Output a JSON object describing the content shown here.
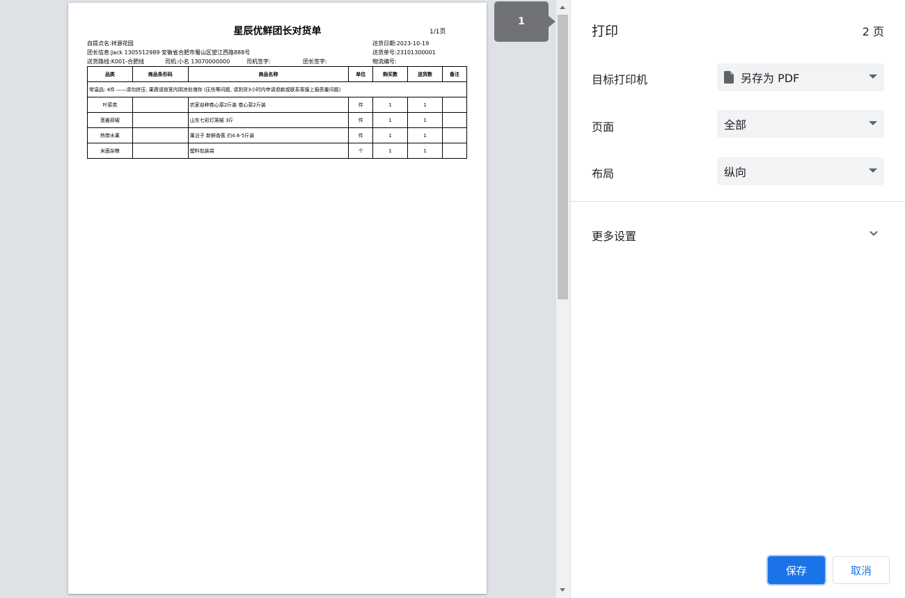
{
  "preview": {
    "thumbnail_page": "1",
    "doc": {
      "title": "星辰优鲜团长对货单",
      "page_num": "1/1页",
      "pickup": "自提点名:祥源花园",
      "leader_info": "团长信息:Jack 1305512989 安徽省合肥市蜀山区望江西路888号",
      "route": "送货路线:K001-合肥线",
      "driver": "司机:小名 13070000000",
      "driver_sign": "司机签字:",
      "leader_sign": "团长签字:",
      "delivery_date": "送货日期:2023-10-19",
      "delivery_no": "送货单号:23101300001",
      "logistics_no": "物流编号:",
      "table": {
        "headers": [
          "品类",
          "商品条形码",
          "商品名称",
          "单位",
          "购买数",
          "送货数",
          "备注"
        ],
        "note_row": "常温品: 4件 ——请勿挤压, 果蔬请放室内阴凉处储存 (压伤等问题, 请到货3小时内申请退款或联系客服上报质量问题)",
        "rows": [
          {
            "category": "叶菜类",
            "barcode": "",
            "name": "农家自种卷心菜2斤装 卷心菜2斤装",
            "unit": "件",
            "bought": "1",
            "delivered": "1",
            "remark": ""
          },
          {
            "category": "葱姜蒜椒",
            "barcode": "",
            "name": "山东七彩灯笼椒 3斤",
            "unit": "件",
            "bought": "1",
            "delivered": "1",
            "remark": ""
          },
          {
            "category": "热带水果",
            "barcode": "",
            "name": "果沿子 新鲜香蕉 约4.6-5斤装",
            "unit": "件",
            "bought": "1",
            "delivered": "1",
            "remark": ""
          },
          {
            "category": "米面杂粮",
            "barcode": "",
            "name": "塑料包装袋",
            "unit": "个",
            "bought": "1",
            "delivered": "1",
            "remark": ""
          }
        ]
      }
    }
  },
  "panel": {
    "title": "打印",
    "sheet_count": "2 页",
    "destination": {
      "label": "目标打印机",
      "value": "另存为 PDF"
    },
    "pages": {
      "label": "页面",
      "value": "全部"
    },
    "layout": {
      "label": "布局",
      "value": "纵向"
    },
    "more_settings": "更多设置",
    "save": "保存",
    "cancel": "取消"
  },
  "colors": {
    "accent": "#1a73e8",
    "panel_bg": "#ffffff",
    "preview_bg": "#dee1e6"
  }
}
